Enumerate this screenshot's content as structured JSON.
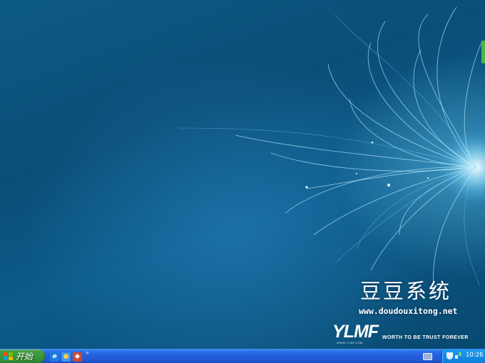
{
  "desktop": {
    "brand_cn": "豆豆系统",
    "brand_url": "www.doudouxitong.net",
    "logo_mark": "YLMF",
    "logo_tagline": "WORTH TO BE TRUST FOREVER",
    "logo_small": "WWW.YLMF.COM"
  },
  "taskbar": {
    "start_label": "开始",
    "quick_launch_icons": [
      "internet-explorer-icon",
      "qq-icon",
      "user-icon"
    ],
    "chevron": "»",
    "clock": "10:26"
  },
  "colors": {
    "taskbar_blue": "#245ddb",
    "start_green": "#3c9a3c",
    "tray_blue": "#148ce6",
    "wallpaper_blue": "#0c5a84"
  }
}
